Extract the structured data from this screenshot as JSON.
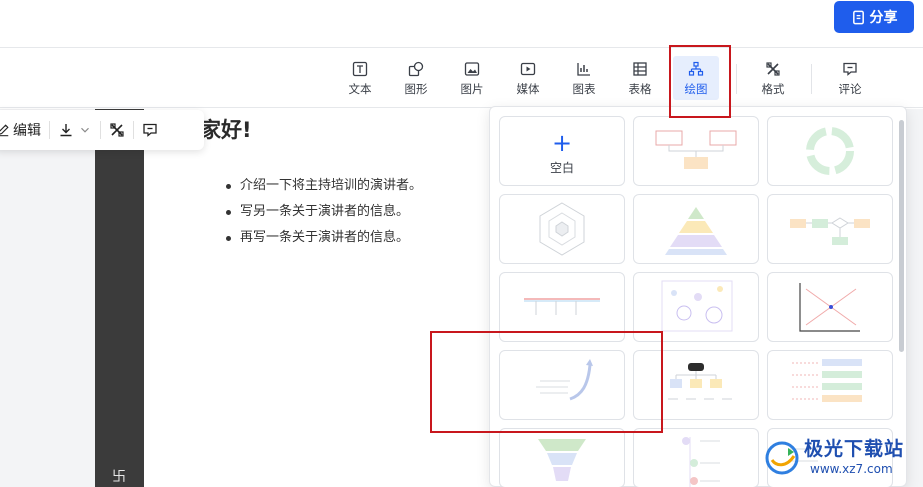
{
  "header": {
    "share_label": "分享"
  },
  "toolbar": {
    "items": [
      {
        "label": "文本",
        "icon": "text-icon"
      },
      {
        "label": "图形",
        "icon": "shapes-icon"
      },
      {
        "label": "图片",
        "icon": "image-icon"
      },
      {
        "label": "媒体",
        "icon": "media-icon"
      },
      {
        "label": "图表",
        "icon": "chart-icon"
      },
      {
        "label": "表格",
        "icon": "table-icon"
      },
      {
        "label": "绘图",
        "icon": "diagram-icon",
        "active": true
      },
      {
        "label": "格式",
        "icon": "format-icon"
      },
      {
        "label": "评论",
        "icon": "comment-icon"
      }
    ]
  },
  "float_toolbar": {
    "edit_label": "编辑"
  },
  "slide": {
    "title": "家好!",
    "bullets": [
      "介绍一下将主持培训的演讲者。",
      "写另一条关于演讲者的信息。",
      "再写一条关于演讲者的信息。"
    ],
    "side_glyph": "卐"
  },
  "drawing_panel": {
    "blank_label": "空白"
  },
  "watermark": {
    "main": "极光下载站",
    "sub": "www.xz7.com"
  },
  "colors": {
    "accent": "#1f5dec",
    "highlight": "#c8171d",
    "active_bg": "#e6eefd"
  }
}
